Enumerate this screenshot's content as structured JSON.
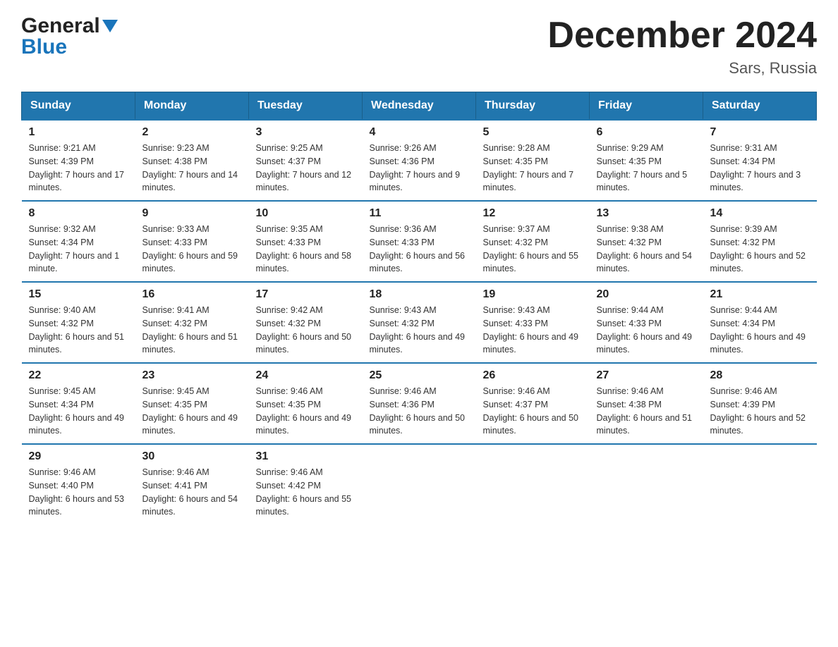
{
  "header": {
    "logo_general": "General",
    "logo_blue": "Blue",
    "month_title": "December 2024",
    "location": "Sars, Russia"
  },
  "weekdays": [
    "Sunday",
    "Monday",
    "Tuesday",
    "Wednesday",
    "Thursday",
    "Friday",
    "Saturday"
  ],
  "weeks": [
    [
      {
        "day": "1",
        "sunrise": "9:21 AM",
        "sunset": "4:39 PM",
        "daylight": "7 hours and 17 minutes."
      },
      {
        "day": "2",
        "sunrise": "9:23 AM",
        "sunset": "4:38 PM",
        "daylight": "7 hours and 14 minutes."
      },
      {
        "day": "3",
        "sunrise": "9:25 AM",
        "sunset": "4:37 PM",
        "daylight": "7 hours and 12 minutes."
      },
      {
        "day": "4",
        "sunrise": "9:26 AM",
        "sunset": "4:36 PM",
        "daylight": "7 hours and 9 minutes."
      },
      {
        "day": "5",
        "sunrise": "9:28 AM",
        "sunset": "4:35 PM",
        "daylight": "7 hours and 7 minutes."
      },
      {
        "day": "6",
        "sunrise": "9:29 AM",
        "sunset": "4:35 PM",
        "daylight": "7 hours and 5 minutes."
      },
      {
        "day": "7",
        "sunrise": "9:31 AM",
        "sunset": "4:34 PM",
        "daylight": "7 hours and 3 minutes."
      }
    ],
    [
      {
        "day": "8",
        "sunrise": "9:32 AM",
        "sunset": "4:34 PM",
        "daylight": "7 hours and 1 minute."
      },
      {
        "day": "9",
        "sunrise": "9:33 AM",
        "sunset": "4:33 PM",
        "daylight": "6 hours and 59 minutes."
      },
      {
        "day": "10",
        "sunrise": "9:35 AM",
        "sunset": "4:33 PM",
        "daylight": "6 hours and 58 minutes."
      },
      {
        "day": "11",
        "sunrise": "9:36 AM",
        "sunset": "4:33 PM",
        "daylight": "6 hours and 56 minutes."
      },
      {
        "day": "12",
        "sunrise": "9:37 AM",
        "sunset": "4:32 PM",
        "daylight": "6 hours and 55 minutes."
      },
      {
        "day": "13",
        "sunrise": "9:38 AM",
        "sunset": "4:32 PM",
        "daylight": "6 hours and 54 minutes."
      },
      {
        "day": "14",
        "sunrise": "9:39 AM",
        "sunset": "4:32 PM",
        "daylight": "6 hours and 52 minutes."
      }
    ],
    [
      {
        "day": "15",
        "sunrise": "9:40 AM",
        "sunset": "4:32 PM",
        "daylight": "6 hours and 51 minutes."
      },
      {
        "day": "16",
        "sunrise": "9:41 AM",
        "sunset": "4:32 PM",
        "daylight": "6 hours and 51 minutes."
      },
      {
        "day": "17",
        "sunrise": "9:42 AM",
        "sunset": "4:32 PM",
        "daylight": "6 hours and 50 minutes."
      },
      {
        "day": "18",
        "sunrise": "9:43 AM",
        "sunset": "4:32 PM",
        "daylight": "6 hours and 49 minutes."
      },
      {
        "day": "19",
        "sunrise": "9:43 AM",
        "sunset": "4:33 PM",
        "daylight": "6 hours and 49 minutes."
      },
      {
        "day": "20",
        "sunrise": "9:44 AM",
        "sunset": "4:33 PM",
        "daylight": "6 hours and 49 minutes."
      },
      {
        "day": "21",
        "sunrise": "9:44 AM",
        "sunset": "4:34 PM",
        "daylight": "6 hours and 49 minutes."
      }
    ],
    [
      {
        "day": "22",
        "sunrise": "9:45 AM",
        "sunset": "4:34 PM",
        "daylight": "6 hours and 49 minutes."
      },
      {
        "day": "23",
        "sunrise": "9:45 AM",
        "sunset": "4:35 PM",
        "daylight": "6 hours and 49 minutes."
      },
      {
        "day": "24",
        "sunrise": "9:46 AM",
        "sunset": "4:35 PM",
        "daylight": "6 hours and 49 minutes."
      },
      {
        "day": "25",
        "sunrise": "9:46 AM",
        "sunset": "4:36 PM",
        "daylight": "6 hours and 50 minutes."
      },
      {
        "day": "26",
        "sunrise": "9:46 AM",
        "sunset": "4:37 PM",
        "daylight": "6 hours and 50 minutes."
      },
      {
        "day": "27",
        "sunrise": "9:46 AM",
        "sunset": "4:38 PM",
        "daylight": "6 hours and 51 minutes."
      },
      {
        "day": "28",
        "sunrise": "9:46 AM",
        "sunset": "4:39 PM",
        "daylight": "6 hours and 52 minutes."
      }
    ],
    [
      {
        "day": "29",
        "sunrise": "9:46 AM",
        "sunset": "4:40 PM",
        "daylight": "6 hours and 53 minutes."
      },
      {
        "day": "30",
        "sunrise": "9:46 AM",
        "sunset": "4:41 PM",
        "daylight": "6 hours and 54 minutes."
      },
      {
        "day": "31",
        "sunrise": "9:46 AM",
        "sunset": "4:42 PM",
        "daylight": "6 hours and 55 minutes."
      },
      null,
      null,
      null,
      null
    ]
  ]
}
